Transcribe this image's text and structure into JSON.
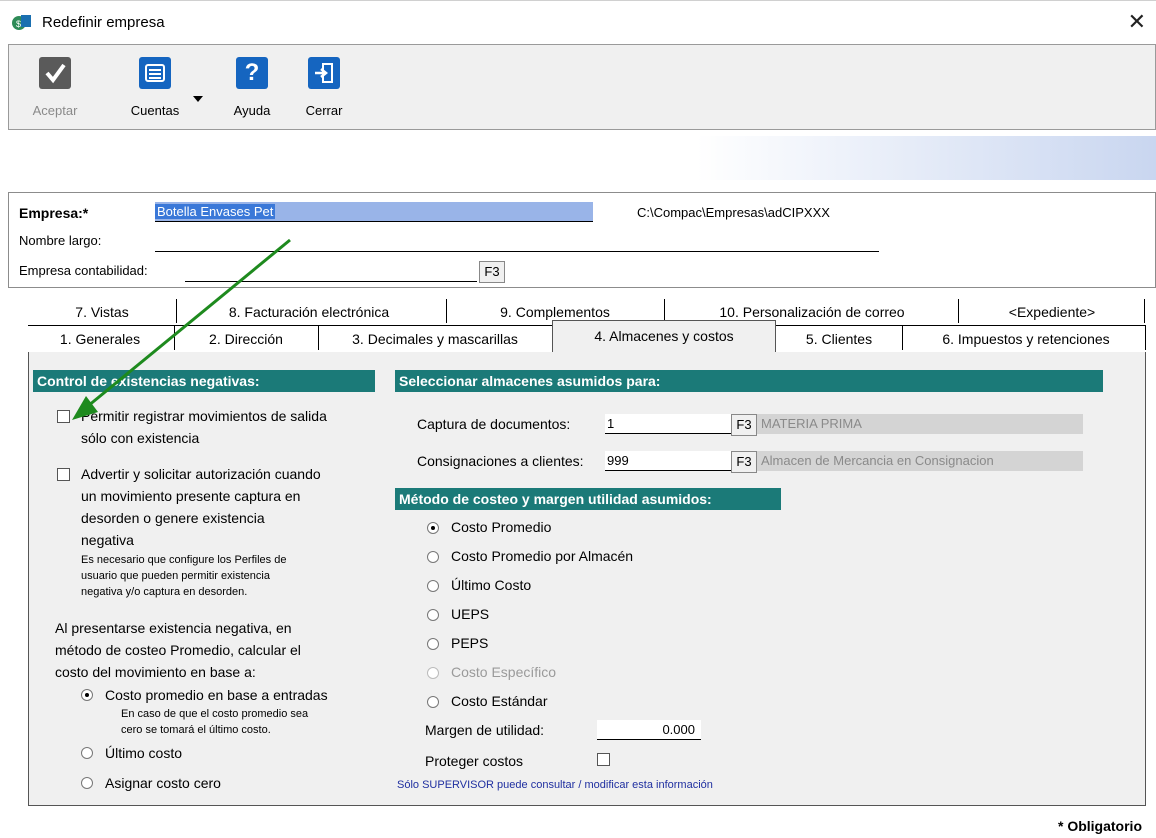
{
  "window": {
    "title": "Redefinir empresa",
    "close_glyph": "✕"
  },
  "toolbar": {
    "aceptar": {
      "label": "Aceptar",
      "icon": "check-icon"
    },
    "cuentas": {
      "label": "Cuentas",
      "icon": "list-icon"
    },
    "ayuda": {
      "label": "Ayuda",
      "icon": "help-icon"
    },
    "cerrar": {
      "label": "Cerrar",
      "icon": "exit-icon"
    }
  },
  "empresa": {
    "label": "Empresa:*",
    "value": "Botella Envases Pet",
    "path": "C:\\Compac\\Empresas\\adCIPXXX",
    "nombre_largo_label": "Nombre largo:",
    "nombre_largo_value": "",
    "contabilidad_label": "Empresa contabilidad:",
    "contabilidad_value": "",
    "f3": "F3"
  },
  "tabs": {
    "row1": [
      "7. Vistas",
      "8. Facturación electrónica",
      "9. Complementos",
      "10. Personalización de correo",
      "<Expediente>"
    ],
    "row2": [
      "1. Generales",
      "2. Dirección",
      "3. Decimales y mascarillas",
      "4. Almacenes y costos",
      "5. Clientes",
      "6. Impuestos y retenciones"
    ]
  },
  "left": {
    "header": "Control de existencias negativas:",
    "cb1_line1": "Permitir registrar movimientos de salida",
    "cb1_line2": "sólo con existencia",
    "cb2_line1": "Advertir y solicitar autorización cuando",
    "cb2_line2": "un movimiento presente captura en",
    "cb2_line3": "desorden o genere existencia",
    "cb2_line4": "negativa",
    "note_line1": "Es necesario que configure los Perfiles de",
    "note_line2": "usuario que pueden permitir existencia",
    "note_line3": "negativa y/o captura en desorden.",
    "para_line1": "Al presentarse existencia negativa, en",
    "para_line2": "método de costeo Promedio, calcular el",
    "para_line3": "costo del movimiento en base a:",
    "opt1": "Costo promedio en base a entradas",
    "opt1_note1": "En caso de que el costo promedio sea",
    "opt1_note2": "cero se tomará el último costo.",
    "opt2": "Último costo",
    "opt3": "Asignar costo cero"
  },
  "right": {
    "header1": "Seleccionar almacenes asumidos para:",
    "captura_label": "Captura de documentos:",
    "captura_value": "1",
    "captura_name": "MATERIA PRIMA",
    "consig_label": "Consignaciones a clientes:",
    "consig_value": "999",
    "consig_name": "Almacen de Mercancia en Consignacion",
    "header2": "Método de costeo y margen utilidad asumidos:",
    "methods": [
      "Costo Promedio",
      "Costo Promedio por Almacén",
      "Último Costo",
      "UEPS",
      "PEPS",
      "Costo Específico",
      "Costo Estándar"
    ],
    "margen_label": "Margen de utilidad:",
    "margen_value": "0.000",
    "proteger_label": "Proteger costos",
    "supervisor_note": "Sólo SUPERVISOR puede consultar / modificar esta información"
  },
  "footer": {
    "obligatorio": "* Obligatorio"
  },
  "colors": {
    "section_header": "#1b7a78",
    "selection": "#99b4e8",
    "arrow": "#1e8a1e"
  }
}
